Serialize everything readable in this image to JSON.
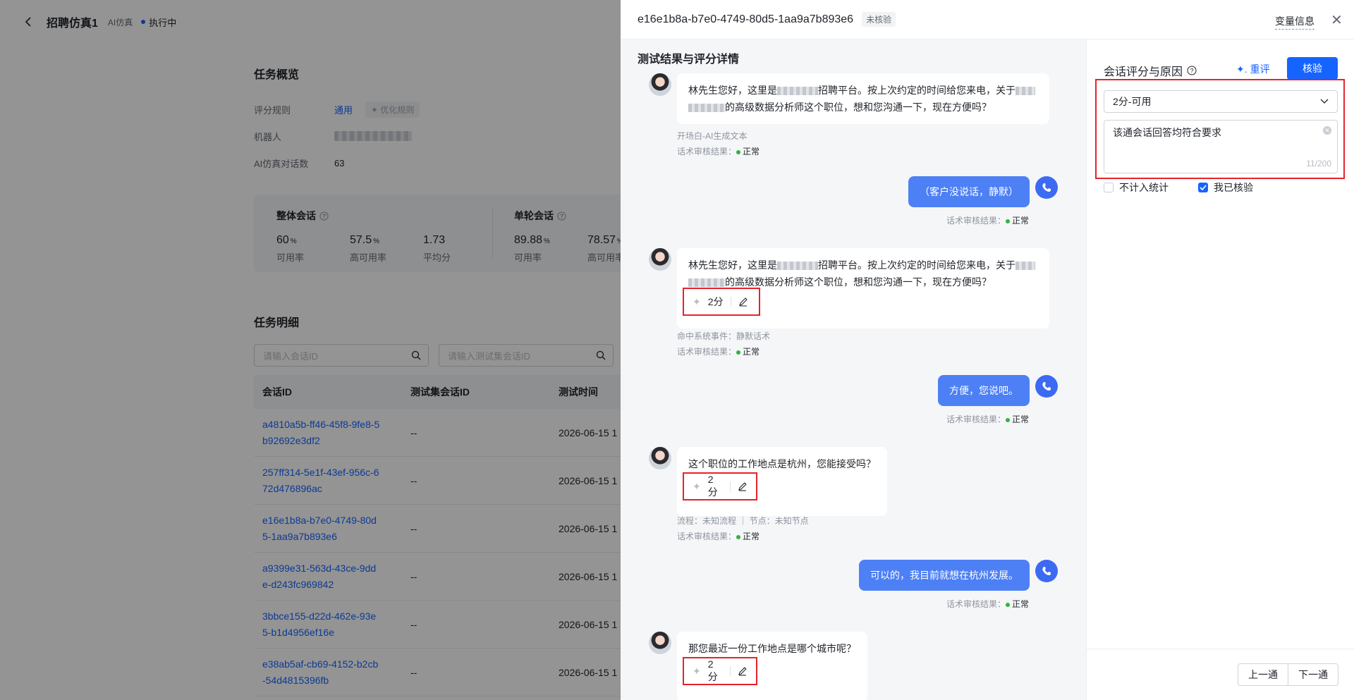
{
  "background": {
    "header": {
      "title": "招聘仿真1",
      "tag": "AI仿真",
      "status": "执行中"
    },
    "overview": {
      "title": "任务概览",
      "rule_label": "评分规则",
      "rule_value": "通用",
      "optimize_label": "优化规则",
      "robot_label": "机器人",
      "dialog_count_label": "AI仿真对话数",
      "dialog_count_value": "63"
    },
    "stats": {
      "overall": {
        "title": "整体会话",
        "items": [
          {
            "num": "60",
            "unit": "%",
            "label": "可用率"
          },
          {
            "num": "57.5",
            "unit": "%",
            "label": "高可用率"
          },
          {
            "num": "1.73",
            "unit": "",
            "label": "平均分"
          }
        ]
      },
      "single": {
        "title": "单轮会话",
        "items": [
          {
            "num": "89.88",
            "unit": "%",
            "label": "可用率"
          },
          {
            "num": "78.57",
            "unit": "%",
            "label": "高可用率"
          }
        ]
      }
    },
    "details": {
      "title": "任务明细",
      "search1_placeholder": "请输入会话ID",
      "search2_placeholder": "请输入测试集会话ID",
      "columns": [
        "会话ID",
        "测试集会话ID",
        "测试时间"
      ],
      "rows": [
        {
          "id": "a4810a5b-ff46-45f8-9fe8-5b92692e3df2",
          "set_id": "--",
          "time": "2026-06-15 1"
        },
        {
          "id": "257ff314-5e1f-43ef-956c-672d476896ac",
          "set_id": "--",
          "time": "2026-06-15 1"
        },
        {
          "id": "e16e1b8a-b7e0-4749-80d5-1aa9a7b893e6",
          "set_id": "--",
          "time": "2026-06-15 1"
        },
        {
          "id": "a9399e31-563d-43ce-9dde-d243fc969842",
          "set_id": "--",
          "time": "2026-06-15 1"
        },
        {
          "id": "3bbce155-d22d-462e-93e5-b1d4956ef16e",
          "set_id": "--",
          "time": "2026-06-15 1"
        },
        {
          "id": "e38ab5af-cb69-4152-b2cb-54d4815396fb",
          "set_id": "--",
          "time": "2026-06-15 1"
        }
      ]
    }
  },
  "drawer": {
    "title": "e16e1b8a-b7e0-4749-80d5-1aa9a7b893e6",
    "badge": "未核验",
    "var_info": "变量信息",
    "chat": {
      "title": "测试结果与评分详情",
      "msg1_a": "林先生您好，这里是",
      "msg1_b": "招聘平台。按上次约定的时间给您来电，关于",
      "msg1_c": "的高级数据分析师这个职位，想和您沟通一下，现在方便吗？",
      "meta1_a": "开场白-AI生成文本",
      "audit_label": "话术审核结果：",
      "audit_ok": "正常",
      "user1": "（客户没说话，静默）",
      "score": "2分",
      "meta2_a": "命中系统事件：静默话术",
      "user2": "方便，您说吧。",
      "msg3": "这个职位的工作地点是杭州，您能接受吗？",
      "meta3_a": "流程：未知流程 ｜ 节点：未知节点",
      "user3": "可以的，我目前就想在杭州发展。",
      "msg4": "那您最近一份工作地点是哪个城市呢？"
    },
    "review": {
      "title": "会话评分与原因",
      "rescore": "重评",
      "verify": "核验",
      "select_value": "2分-可用",
      "reason": "该通会话回答均符合要求",
      "count": "11/200",
      "exclude_label": "不计入统计",
      "verified_label": "我已核验",
      "prev": "上一通",
      "next": "下一通"
    }
  }
}
